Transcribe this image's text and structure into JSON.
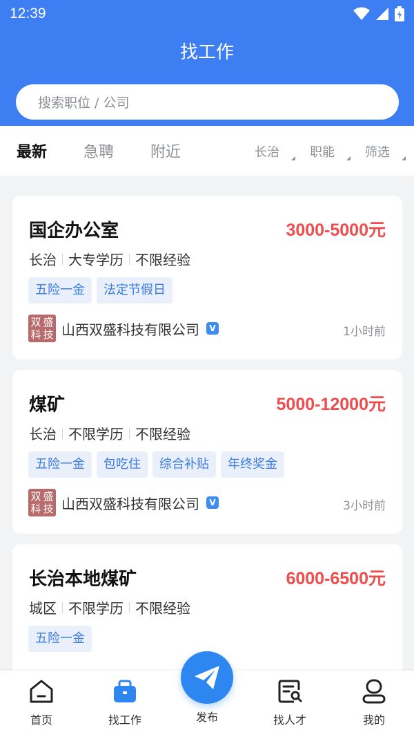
{
  "status_bar": {
    "time": "12:39"
  },
  "header": {
    "title": "找工作",
    "search_placeholder": "搜索职位 / 公司"
  },
  "tabs": [
    {
      "label": "最新",
      "active": true
    },
    {
      "label": "急聘",
      "active": false
    },
    {
      "label": "附近",
      "active": false
    }
  ],
  "filters": [
    {
      "label": "长治"
    },
    {
      "label": "职能"
    },
    {
      "label": "筛选"
    }
  ],
  "jobs": [
    {
      "title": "国企办公室",
      "salary": "3000-5000元",
      "location": "长治",
      "education": "大专学历",
      "experience": "不限经验",
      "tags": [
        "五险一金",
        "法定节假日"
      ],
      "company": "山西双盛科技有限公司",
      "logo_chars": [
        "双",
        "盛",
        "科",
        "技"
      ],
      "posted": "1小时前"
    },
    {
      "title": "煤矿",
      "salary": "5000-12000元",
      "location": "长治",
      "education": "不限学历",
      "experience": "不限经验",
      "tags": [
        "五险一金",
        "包吃住",
        "综合补贴",
        "年终奖金"
      ],
      "company": "山西双盛科技有限公司",
      "logo_chars": [
        "双",
        "盛",
        "科",
        "技"
      ],
      "posted": "3小时前"
    },
    {
      "title": "长治本地煤矿",
      "salary": "6000-6500元",
      "location": "城区",
      "education": "不限学历",
      "experience": "不限经验",
      "tags": [
        "五险一金"
      ]
    }
  ],
  "bottom_nav": {
    "home": "首页",
    "jobs": "找工作",
    "publish": "发布",
    "talent": "找人才",
    "mine": "我的"
  },
  "colors": {
    "primary": "#3d7ef3",
    "salary": "#ef4d4d",
    "tag_bg": "#e9f0fc",
    "tag_text": "#3b7be3"
  },
  "icons": {
    "status": [
      "wifi-icon",
      "signal-icon",
      "battery-charging-icon"
    ],
    "nav": [
      "home-icon",
      "briefcase-icon",
      "paper-plane-icon",
      "resume-search-icon",
      "user-icon"
    ]
  }
}
